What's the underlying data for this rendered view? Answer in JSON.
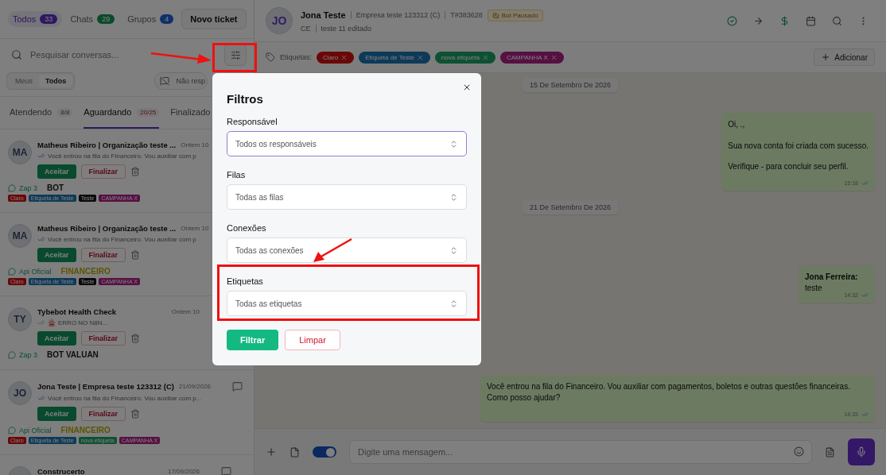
{
  "sidebar": {
    "scope_tabs": [
      {
        "label": "Todos",
        "count": "33",
        "color": "#2e1860",
        "selected": true
      },
      {
        "label": "Chats",
        "count": "29",
        "color": "#0a4a2a",
        "selected": false
      },
      {
        "label": "Grupos",
        "count": "4",
        "color": "#10306a",
        "selected": false
      }
    ],
    "new_ticket_button": "Novo ticket",
    "search": {
      "placeholder": "Pesquisar conversas..."
    },
    "owner_toggle": [
      {
        "label": "Meus",
        "selected": false
      },
      {
        "label": "Todos",
        "selected": true
      }
    ],
    "unanswered_filter": "Não resp",
    "status_tabs": [
      {
        "label": "Atendendo",
        "count": "8/8",
        "selected": false
      },
      {
        "label": "Aguardando",
        "count": "20/25",
        "selected": true
      },
      {
        "label": "Finalizado",
        "selected": false
      }
    ],
    "conversations": [
      {
        "initials": "MA",
        "title": "Matheus Ribeiro | Organização teste ...",
        "time": "Ontem 10",
        "preview": "Você entrou na fila do Financeiro. Vou auxiliar com p",
        "read": true,
        "alert": false,
        "message_icon": false,
        "accept": "Aceitar",
        "finish": "Finalizar",
        "connection": "Zap 3",
        "queue": {
          "label": "BOT",
          "kind": "bot"
        },
        "tags": [
          {
            "label": "Claro",
            "color": "#6a0808"
          },
          {
            "label": "Etiqueta de Teste",
            "color": "#0e3a58"
          },
          {
            "label": "Teste",
            "color": "#0a0a0a"
          },
          {
            "label": "CAMPANHA X",
            "color": "#561042"
          }
        ]
      },
      {
        "initials": "MA",
        "title": "Matheus Ribeiro | Organização teste ...",
        "time": "Ontem 10",
        "preview": "Você entrou na fila do Financeiro. Vou auxiliar com p",
        "read": true,
        "alert": false,
        "message_icon": false,
        "accept": "Aceitar",
        "finish": "Finalizar",
        "connection": "Api Oficial",
        "queue": {
          "label": "FINANCEIRO",
          "kind": "department"
        },
        "tags": [
          {
            "label": "Claro",
            "color": "#6a0808"
          },
          {
            "label": "Etiqueta de Teste",
            "color": "#0e3a58"
          },
          {
            "label": "Teste",
            "color": "#0a0a0a"
          },
          {
            "label": "CAMPANHA X",
            "color": "#561042"
          }
        ]
      },
      {
        "initials": "TY",
        "title": "Tybebot Health Check",
        "time": "Ontem 10",
        "preview": "ERRO NO N8N...",
        "read": false,
        "alert": true,
        "message_icon": false,
        "accept": "Aceitar",
        "finish": "Finalizar",
        "connection": "Zap 3",
        "queue": {
          "label": "BOT VALUAN",
          "kind": "bot"
        }
      },
      {
        "initials": "JO",
        "title": "Jona Teste | Empresa teste 123312 (C)",
        "time": "21/09/2026",
        "preview": "Você entrou na fila do Financeiro. Vou auxiliar com p...",
        "read": true,
        "alert": false,
        "message_icon": true,
        "accept": "Aceitar",
        "finish": "Finalizar",
        "connection": "Api Oficial",
        "queue": {
          "label": "FINANCEIRO",
          "kind": "department"
        },
        "tags": [
          {
            "label": "Claro",
            "color": "#6a0808"
          },
          {
            "label": "Etiqueta de Teste",
            "color": "#0e3a58"
          },
          {
            "label": "nova etiqueta",
            "color": "#0e5034"
          },
          {
            "label": "CAMPANHA X",
            "color": "#561042"
          }
        ]
      },
      {
        "title": "Construcerto",
        "time": "17/09/2026",
        "message_icon": true
      }
    ]
  },
  "chat": {
    "header": {
      "initials": "JO",
      "name": "Jona Teste",
      "company": "Empresa teste 123312 (C)",
      "ticket": "T#383628",
      "bot_badge": "Bot Pausado",
      "state": "CE",
      "note": "teste 11 editado"
    },
    "tags_label": "Etiquetas:",
    "tags": [
      {
        "label": "Claro",
        "color": "#6a0808"
      },
      {
        "label": "Etiqueta de Teste",
        "color": "#0e3a58"
      },
      {
        "label": "nova etiqueta",
        "color": "#0e5034"
      },
      {
        "label": "CAMPANHA X",
        "color": "#561042"
      }
    ],
    "add_tag_button": "Adicionar",
    "timeline": [
      {
        "kind": "date",
        "text": "15 De Setembro De 2026"
      },
      {
        "kind": "message",
        "lines": [
          "Oi, .,",
          "Sua nova conta foi criada com sucesso.",
          "Verifique - para concluir seu perfil."
        ],
        "time": "15:18"
      },
      {
        "kind": "date",
        "text": "21 De Setembro De 2026"
      },
      {
        "kind": "message",
        "sender": "Jona Ferreira:",
        "lines": [
          "teste"
        ],
        "time": "14:32"
      },
      {
        "kind": "gap"
      },
      {
        "kind": "message",
        "lines": [
          "Você entrou na fila do Financeiro. Vou auxiliar com pagamentos, boletos e outras questões financeiras. Como posso ajudar?"
        ],
        "time": "14:33"
      }
    ],
    "composer": {
      "signature_toggle_on": true,
      "placeholder": "Digite uma mensagem..."
    }
  },
  "filter_dialog": {
    "title": "Filtros",
    "fields": [
      {
        "label": "Responsável",
        "value": "Todos os responsáveis",
        "focused": true
      },
      {
        "label": "Filas",
        "value": "Todas as filas",
        "focused": false
      },
      {
        "label": "Conexões",
        "value": "Todas as conexões",
        "focused": false
      },
      {
        "label": "Etiquetas",
        "value": "Todas as etiquetas",
        "focused": false
      }
    ],
    "apply_button": "Filtrar",
    "clear_button": "Limpar"
  }
}
